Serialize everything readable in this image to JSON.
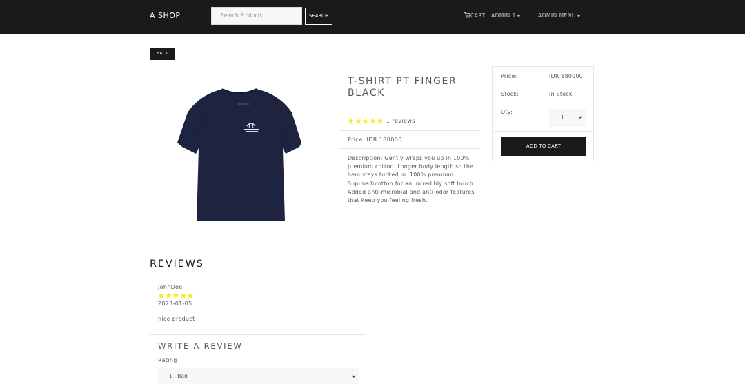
{
  "navbar": {
    "brand": "A SHOP",
    "search_placeholder": "Search Products . . .",
    "search_button": "SEARCH",
    "cart_label": "CART",
    "admin_user_label": "ADMIN 1",
    "admin_menu_label": "ADMIN MENU"
  },
  "back_button": "BACK",
  "product": {
    "name": "T-Shirt PT Finger Black",
    "rating": 5,
    "reviews_text": "1 reviews",
    "price_line": "Price: IDR 180000",
    "description": "Description: Gently wraps you up in 100% premium cotton. Longer body length so the hem stays tucked in. 100% premium Supima®cotton for an incredibly soft touch. Added anti-microbial and anti-odor features that keep you feeling fresh.",
    "image_icon": "t-shirt-image",
    "colors": {
      "shirt": "#1e2440",
      "star": "#f8e825"
    }
  },
  "purchase_card": {
    "price_label": "Price:",
    "price_value": "IDR 180000",
    "stock_label": "Stock:",
    "stock_value": "In Stock",
    "qty_label": "Qty:",
    "qty_value": "1",
    "add_to_cart": "ADD TO CART"
  },
  "reviews": {
    "heading": "REVIEWS",
    "items": [
      {
        "user": "JohnDoe",
        "rating": 5,
        "date": "2023-01-05",
        "comment": "nice product"
      }
    ]
  },
  "write_review": {
    "heading": "WRITE A REVIEW",
    "rating_label": "Rating",
    "rating_value": "1 - Bad"
  }
}
